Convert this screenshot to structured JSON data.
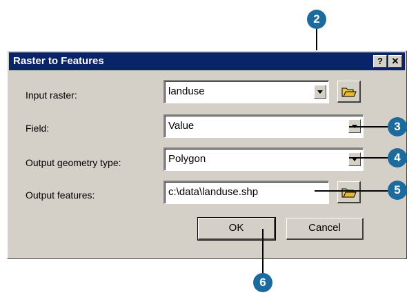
{
  "dialog": {
    "title": "Raster to Features",
    "help_glyph": "?",
    "close_glyph": "✕"
  },
  "form": {
    "input_raster_label": "Input raster:",
    "input_raster_value": "landuse",
    "field_label": "Field:",
    "field_value": "Value",
    "geometry_label": "Output geometry type:",
    "geometry_value": "Polygon",
    "output_label": "Output features:",
    "output_value": "c:\\data\\landuse.shp"
  },
  "buttons": {
    "ok": "OK",
    "cancel": "Cancel"
  },
  "callouts": [
    "2",
    "3",
    "4",
    "5",
    "6"
  ],
  "colors": {
    "titlebar": "#0a246a",
    "dialog_face": "#d4d0c8",
    "callout": "#1b6b9e"
  },
  "icons": [
    "help-icon",
    "close-icon",
    "dropdown-arrow-icon",
    "open-folder-icon"
  ]
}
